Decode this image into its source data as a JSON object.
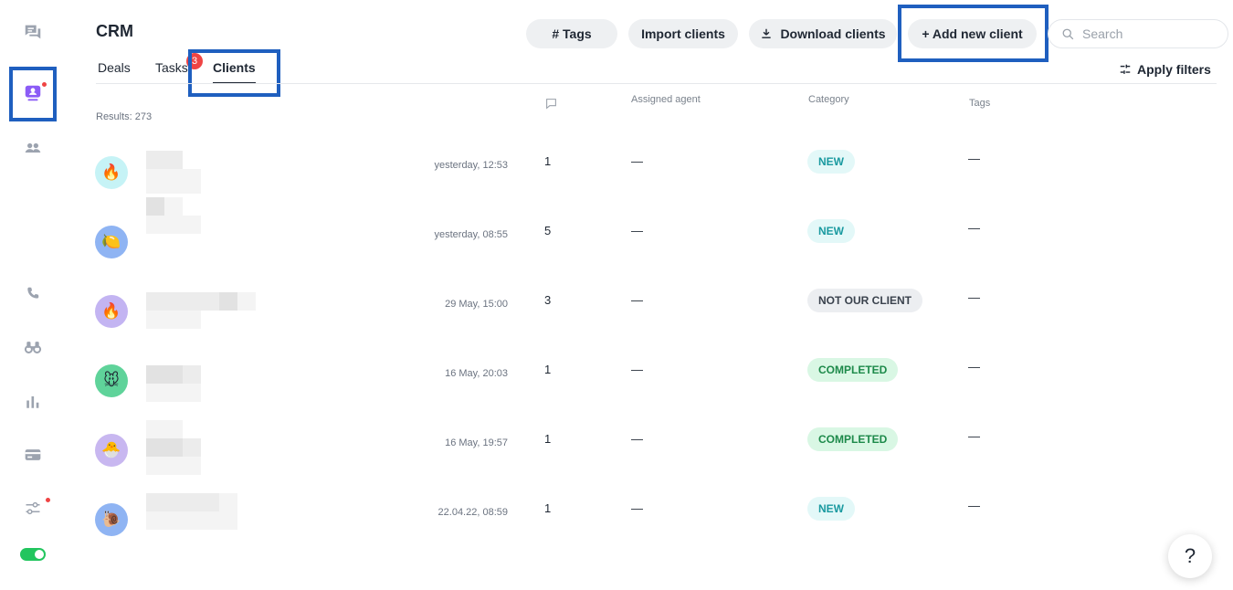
{
  "header": {
    "title": "CRM",
    "buttons": {
      "tags": "# Tags",
      "import": "Import clients",
      "download": "Download clients",
      "add": "+ Add new client"
    },
    "search_placeholder": "Search",
    "apply_filters": "Apply filters"
  },
  "tabs": {
    "deals": "Deals",
    "tasks": "Tasks",
    "tasks_badge": "3",
    "clients": "Clients"
  },
  "table": {
    "results": "Results: 273",
    "columns": {
      "messages_icon": "comment-icon",
      "assigned_agent": "Assigned agent",
      "category": "Category",
      "tags": "Tags"
    },
    "rows": [
      {
        "avatar_emoji": "🔥",
        "avatar_color": "#c6f3f6",
        "date": "yesterday, 12:53",
        "count": "1",
        "agent": "—",
        "category": "NEW",
        "tags": "—"
      },
      {
        "avatar_emoji": "🍋",
        "avatar_color": "#8fb4f3",
        "date": "yesterday, 08:55",
        "count": "5",
        "agent": "—",
        "category": "NEW",
        "tags": "—"
      },
      {
        "avatar_emoji": "🔥",
        "avatar_color": "#c3b4f2",
        "date": "29 May, 15:00",
        "count": "3",
        "agent": "—",
        "category": "NOT OUR CLIENT",
        "tags": "—"
      },
      {
        "avatar_emoji": "🐭",
        "avatar_color": "#5fd39a",
        "date": "16 May, 20:03",
        "count": "1",
        "agent": "—",
        "category": "COMPLETED",
        "tags": "—"
      },
      {
        "avatar_emoji": "🐣",
        "avatar_color": "#c8b7f0",
        "date": "16 May, 19:57",
        "count": "1",
        "agent": "—",
        "category": "COMPLETED",
        "tags": "—"
      },
      {
        "avatar_emoji": "🐌",
        "avatar_color": "#8fb4f3",
        "date": "22.04.22, 08:59",
        "count": "1",
        "agent": "—",
        "category": "NEW",
        "tags": "—"
      }
    ]
  },
  "category_colors": {
    "NEW": {
      "bg": "#e3f8f8",
      "fg": "#1a9aa0"
    },
    "NOT OUR CLIENT": {
      "bg": "#eceef1",
      "fg": "#3a424d"
    },
    "COMPLETED": {
      "bg": "#d9f7e4",
      "fg": "#1d8a4a"
    }
  },
  "sidebar_icons": [
    "chat-icon",
    "crm-icon",
    "contacts-icon",
    "phone-icon",
    "binoculars-icon",
    "analytics-icon",
    "payment-card-icon",
    "settings-sliders-icon"
  ],
  "help_label": "?"
}
